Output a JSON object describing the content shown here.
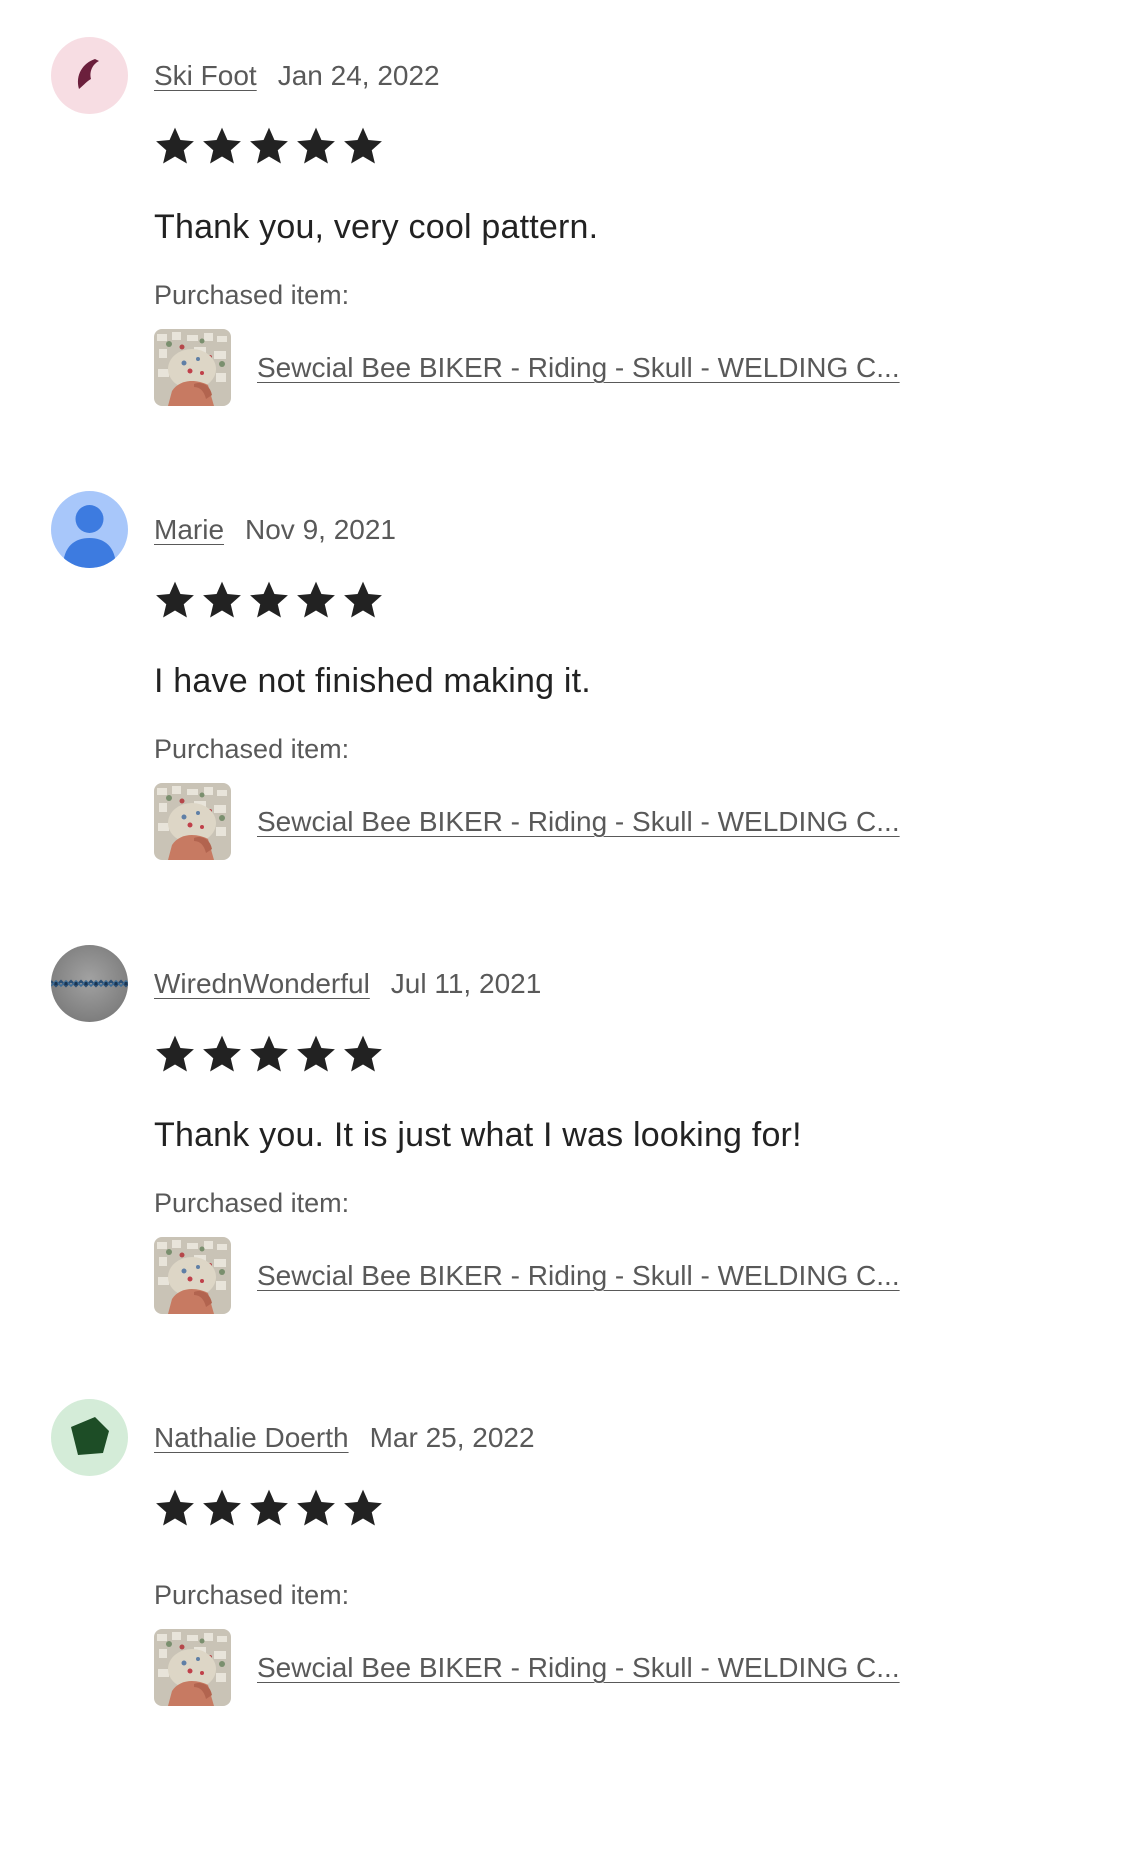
{
  "reviews": [
    {
      "reviewer": "Ski Foot",
      "date": "Jan 24, 2022",
      "rating": 5,
      "text": "Thank you, very cool pattern.",
      "purchased_label": "Purchased item:",
      "item_title": "Sewcial Bee BIKER - Riding - Skull - WELDING C...",
      "avatar": {
        "icon": "crescent-icon",
        "bg": "#f7dde3",
        "fg": "#6b1f3c"
      }
    },
    {
      "reviewer": "Marie",
      "date": "Nov 9, 2021",
      "rating": 5,
      "text": "I have not finished making it.",
      "purchased_label": "Purchased item:",
      "item_title": "Sewcial Bee BIKER - Riding - Skull - WELDING C...",
      "avatar": {
        "icon": "person-icon",
        "bg": "#a8c7fa",
        "fg": "#3d7be0"
      }
    },
    {
      "reviewer": "WirednWonderful",
      "date": "Jul 11, 2021",
      "rating": 5,
      "text": "Thank you. It is just what I was looking for!",
      "purchased_label": "Purchased item:",
      "item_title": "Sewcial Bee BIKER - Riding - Skull - WELDING C...",
      "avatar": {
        "icon": "beaded-wire-icon",
        "bg": "#8e8e8e",
        "fg": "#2b4e73"
      }
    },
    {
      "reviewer": "Nathalie Doerth",
      "date": "Mar 25, 2022",
      "rating": 5,
      "text": "",
      "purchased_label": "Purchased item:",
      "item_title": "Sewcial Bee BIKER - Riding - Skull - WELDING C...",
      "avatar": {
        "icon": "pentagon-icon",
        "bg": "#d4ecd8",
        "fg": "#1d4d26"
      }
    }
  ],
  "colors": {
    "star": "#222222",
    "text": "#222222",
    "muted": "#595959"
  }
}
